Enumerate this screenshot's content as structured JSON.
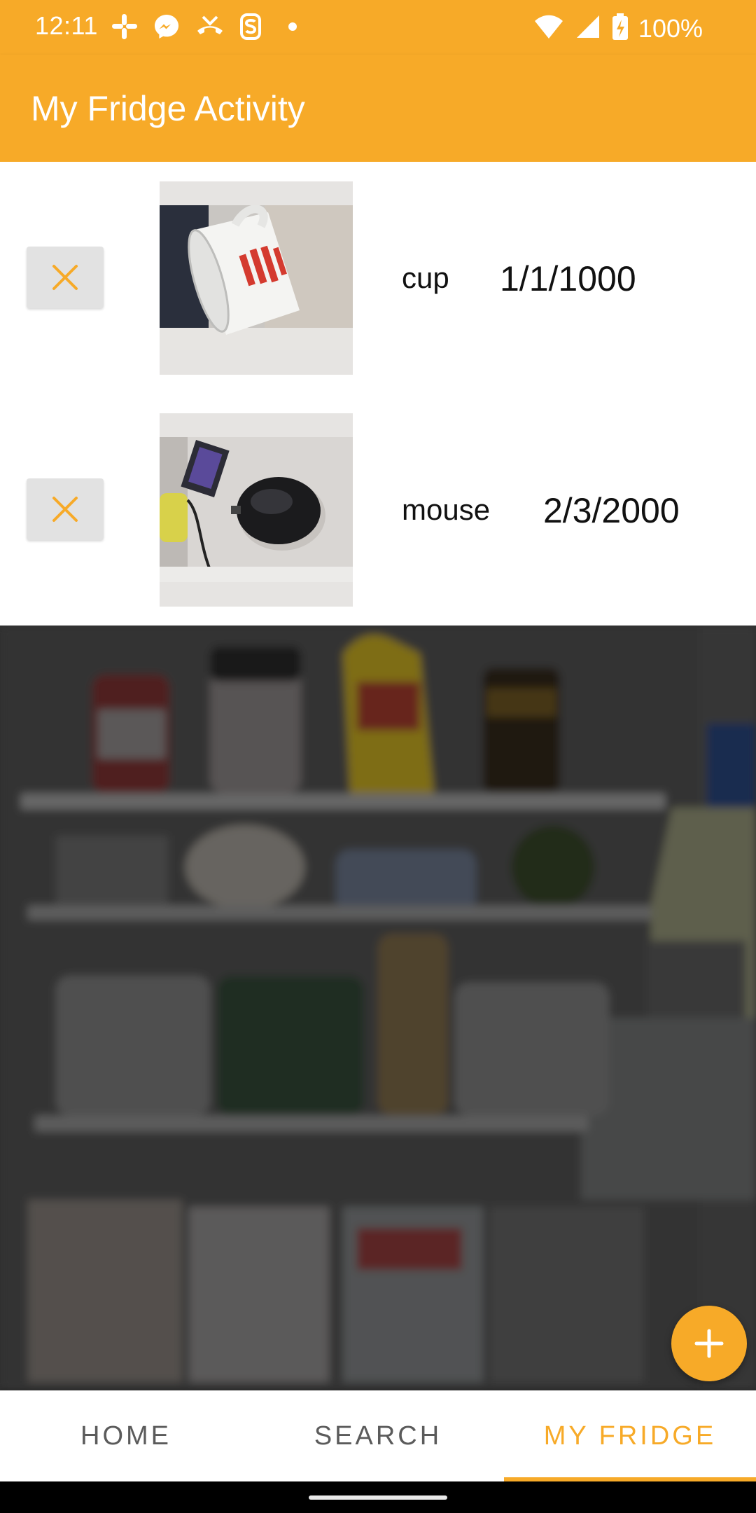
{
  "status_bar": {
    "time": "12:11",
    "notification_icons": [
      "slack-icon",
      "messenger-icon",
      "missed-call-icon",
      "app-icon",
      "dot-icon"
    ],
    "system_icons": [
      "wifi-icon",
      "signal-icon",
      "battery-charging-icon"
    ],
    "battery": "100%"
  },
  "app_bar": {
    "title": "My Fridge Activity"
  },
  "items": [
    {
      "name": "cup",
      "date": "1/1/1000",
      "thumbnail": "cup-photo",
      "delete_icon": "close-icon"
    },
    {
      "name": "mouse",
      "date": "2/3/2000",
      "thumbnail": "mouse-photo",
      "delete_icon": "close-icon"
    }
  ],
  "fab": {
    "icon": "add-icon"
  },
  "bottom_nav": {
    "tabs": [
      {
        "label": "HOME",
        "active": false
      },
      {
        "label": "SEARCH",
        "active": false
      },
      {
        "label": "MY FRIDGE",
        "active": true
      }
    ]
  },
  "colors": {
    "accent": "#F7AA28",
    "delete_button_bg": "#E2E2E2",
    "inactive_tab": "#5B5B5B"
  }
}
